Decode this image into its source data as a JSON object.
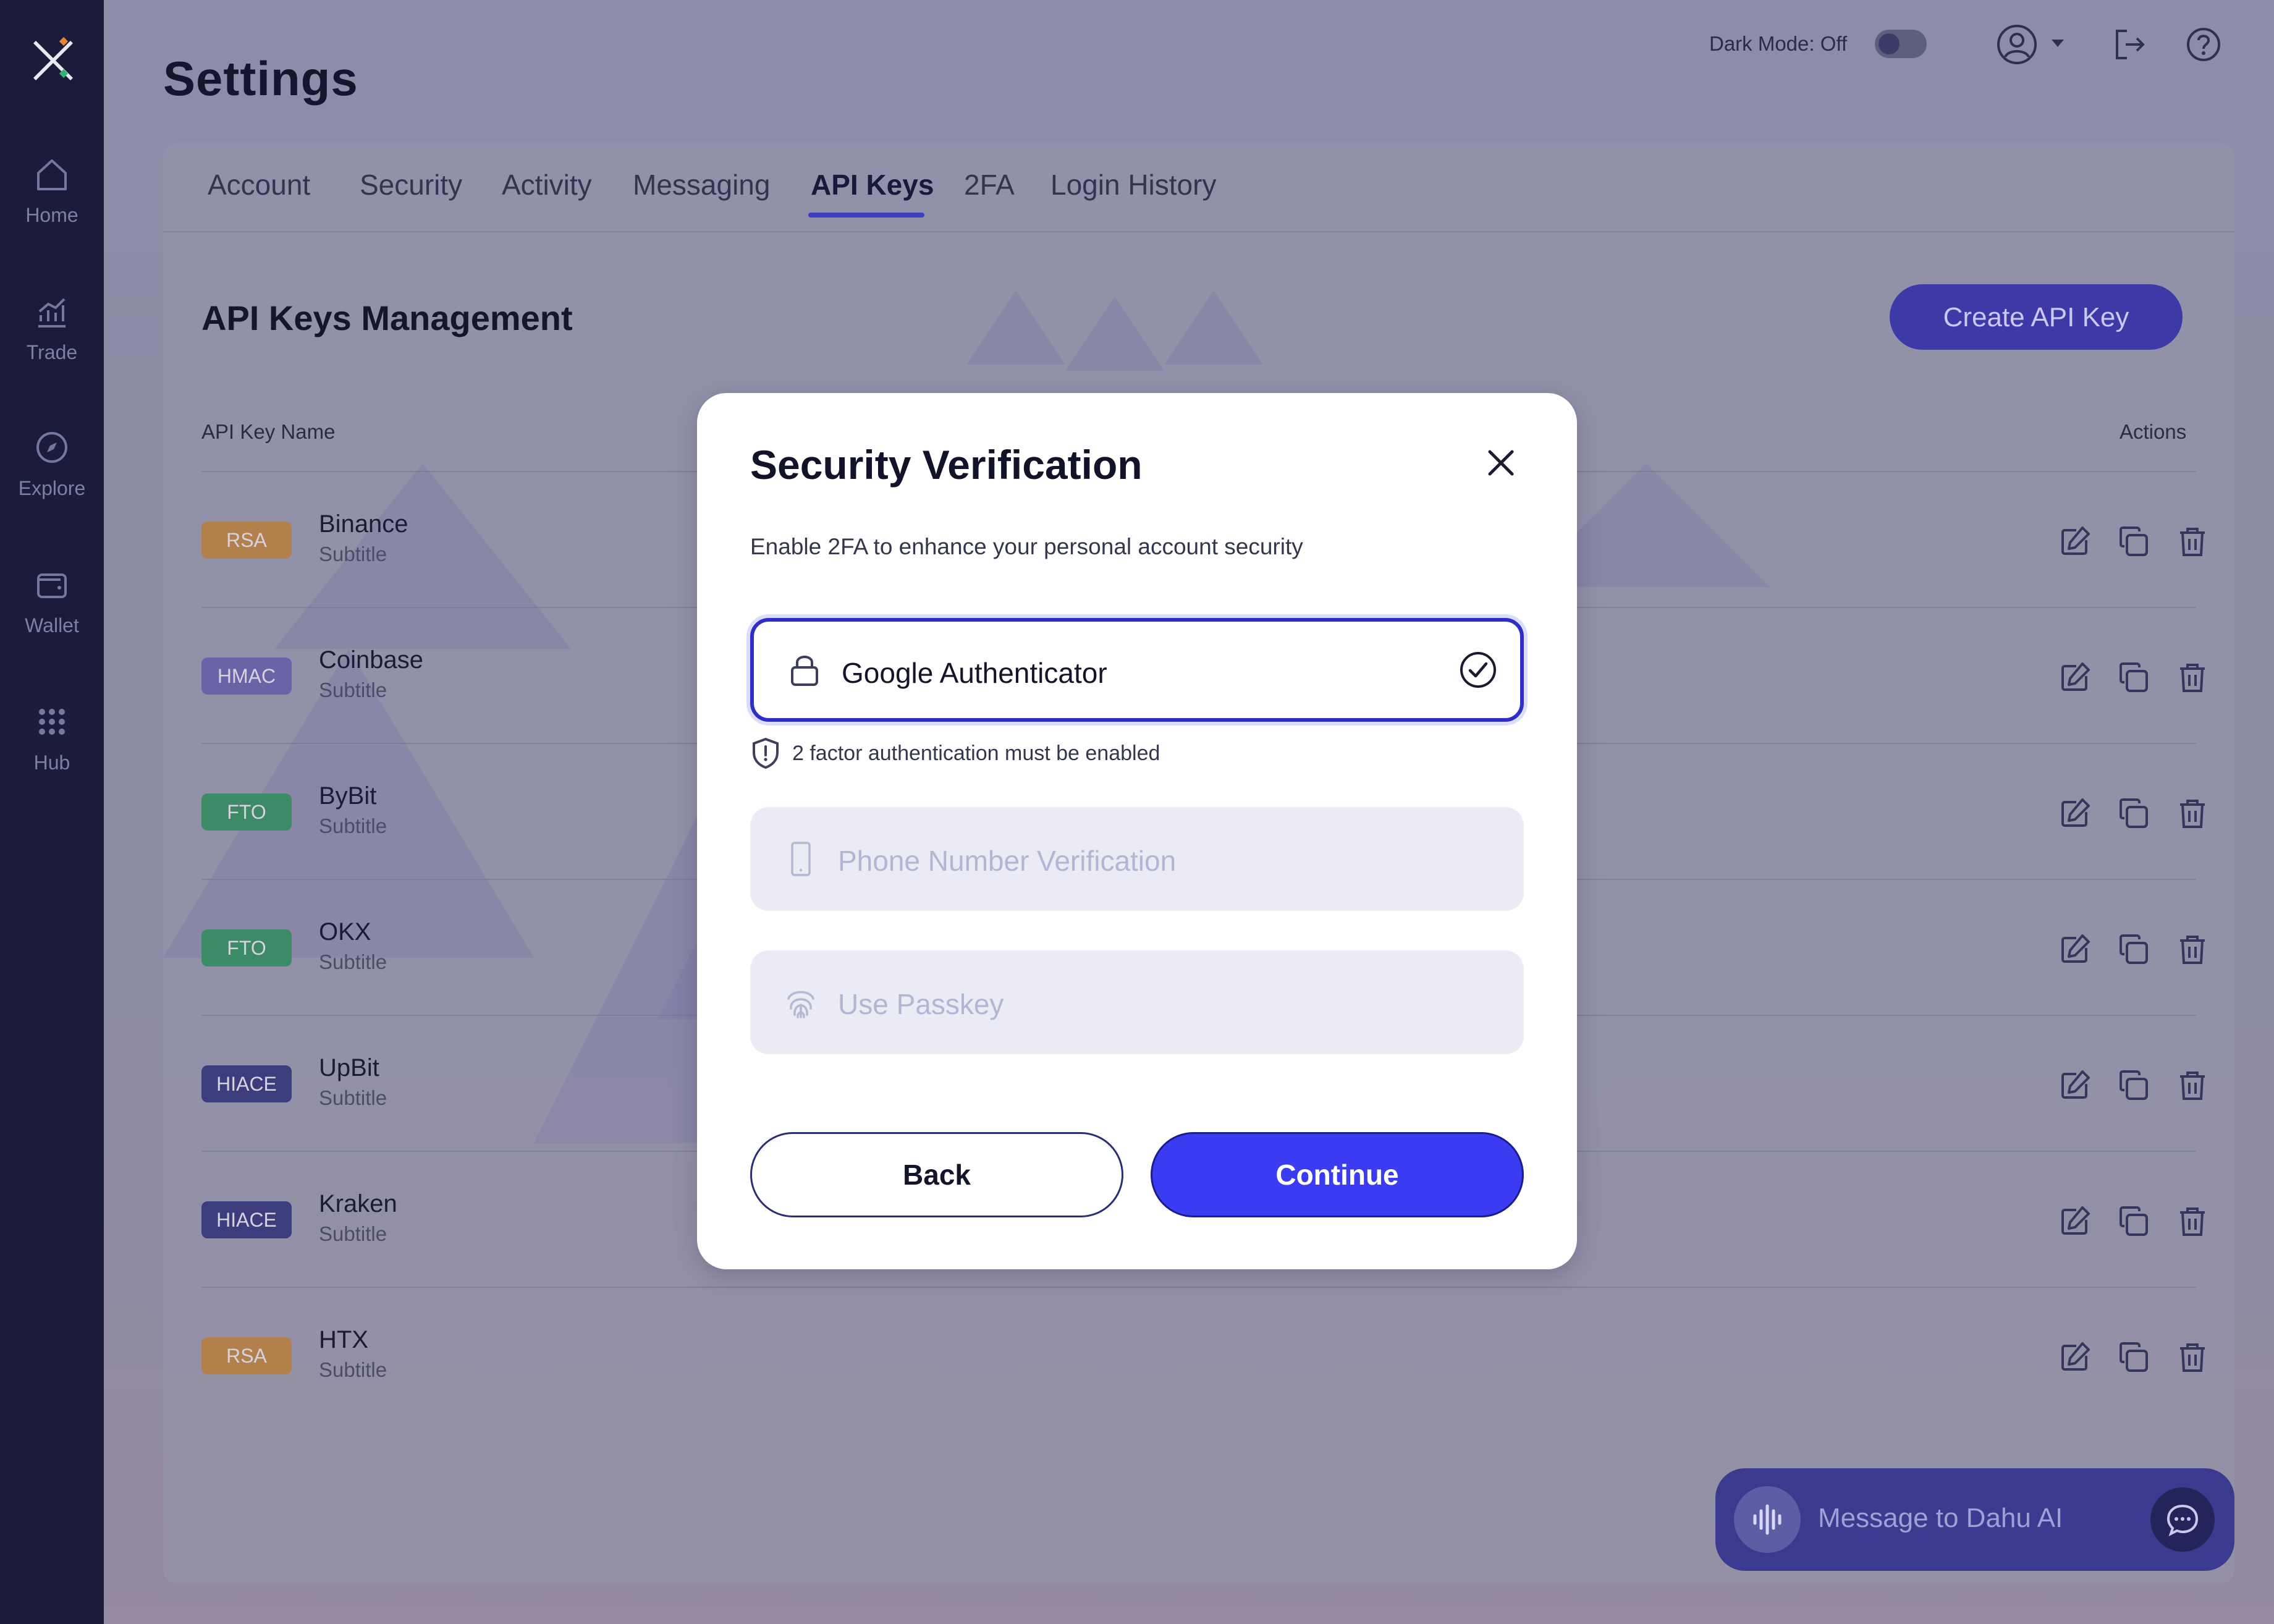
{
  "sidebar": {
    "items": [
      {
        "label": "Home",
        "icon": "home-icon"
      },
      {
        "label": "Trade",
        "icon": "chart-icon"
      },
      {
        "label": "Explore",
        "icon": "compass-icon"
      },
      {
        "label": "Wallet",
        "icon": "wallet-icon"
      },
      {
        "label": "Hub",
        "icon": "grid-icon"
      }
    ]
  },
  "header": {
    "title": "Settings",
    "dark_mode_label": "Dark Mode: Off",
    "dark_mode_on": false
  },
  "tabs": [
    {
      "label": "Account"
    },
    {
      "label": "Security"
    },
    {
      "label": "Activity"
    },
    {
      "label": "Messaging"
    },
    {
      "label": "API Keys",
      "active": true
    },
    {
      "label": "2FA"
    },
    {
      "label": "Login History"
    }
  ],
  "api_section": {
    "title": "API Keys Management",
    "create_button": "Create API Key",
    "col_name": "API Key Name",
    "col_actions": "Actions",
    "rows": [
      {
        "badge": "RSA",
        "badge_color": "#b2804a",
        "name": "Binance",
        "subtitle": "Subtitle"
      },
      {
        "badge": "HMAC",
        "badge_color": "#6b63a8",
        "name": "Coinbase",
        "subtitle": "Subtitle"
      },
      {
        "badge": "FTO",
        "badge_color": "#3c8a66",
        "name": "ByBit",
        "subtitle": "Subtitle"
      },
      {
        "badge": "FTO",
        "badge_color": "#3c8a66",
        "name": "OKX",
        "subtitle": "Subtitle"
      },
      {
        "badge": "HIACE",
        "badge_color": "#3c3d7c",
        "name": "UpBit",
        "subtitle": "Subtitle"
      },
      {
        "badge": "HIACE",
        "badge_color": "#3c3d7c",
        "name": "Kraken",
        "subtitle": "Subtitle"
      },
      {
        "badge": "RSA",
        "badge_color": "#b2804a",
        "name": "HTX",
        "subtitle": "Subtitle"
      }
    ]
  },
  "chat": {
    "placeholder": "Message to Dahu AI"
  },
  "modal": {
    "title": "Security Verification",
    "description": "Enable 2FA to enhance your personal account security",
    "options": [
      {
        "label": "Google Authenticator",
        "icon": "lock-icon",
        "selected": true
      },
      {
        "label": "Phone Number Verification",
        "icon": "phone-icon",
        "selected": false
      },
      {
        "label": "Use Passkey",
        "icon": "fingerprint-icon",
        "selected": false
      }
    ],
    "hint": "2 factor authentication must be enabled",
    "back_label": "Back",
    "continue_label": "Continue"
  },
  "colors": {
    "accent": "#3b3bf2",
    "sidebar_bg": "#1b1c3b",
    "overlay": "#8e8fa6"
  }
}
